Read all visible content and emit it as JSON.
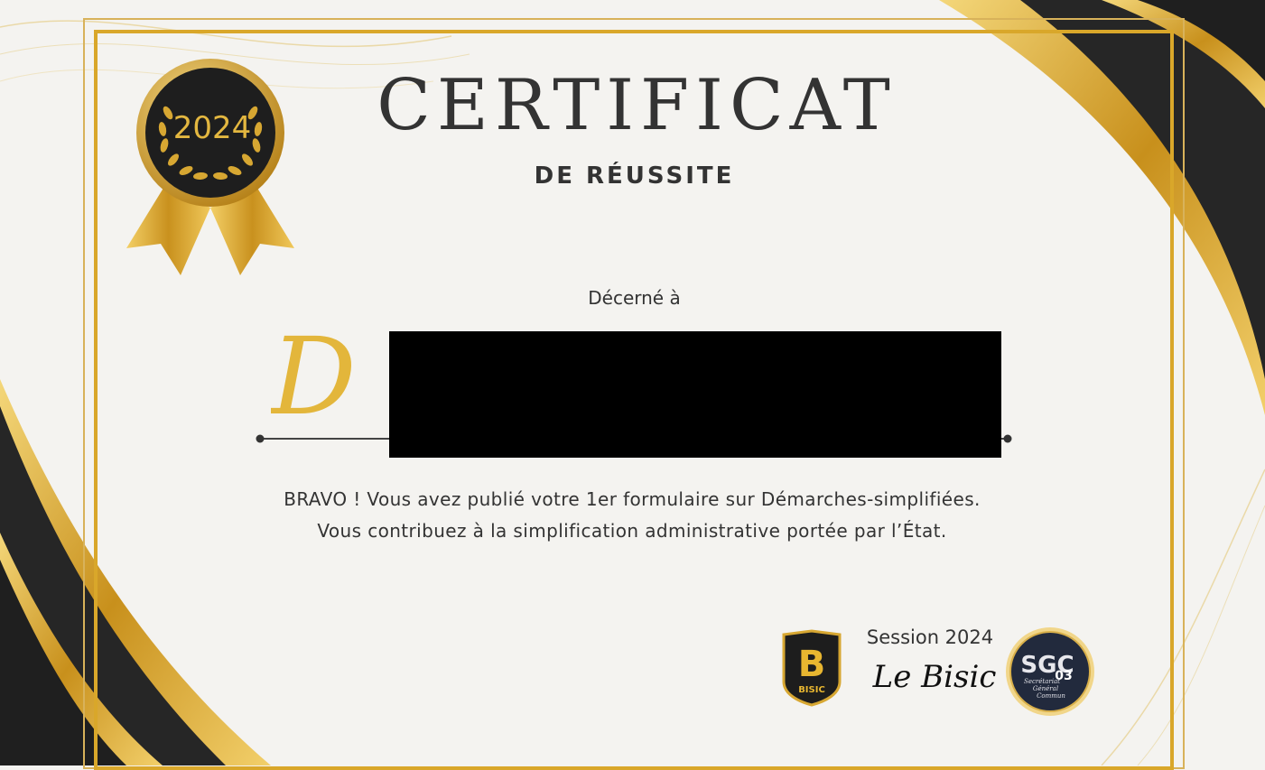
{
  "certificate": {
    "badge_year": "2024",
    "title": "CERTIFICAT",
    "subtitle": "DE RÉUSSITE",
    "awarded_to_label": "Décerné à",
    "recipient_visible_initial": "D",
    "message_line1": "BRAVO ! Vous avez publié votre 1er formulaire sur Démarches-simplifiées.",
    "message_line2": "Vous contribuez à la simplification administrative portée par l’État.",
    "session": "Session 2024",
    "signature": "Le Bisic"
  },
  "logos": {
    "bisic_text": "BISIC",
    "bisic_letter": "B",
    "sgc_text": "SGC",
    "sgc_number": "03",
    "sgc_subtext_1": "Secrétariat",
    "sgc_subtext_2": "Général",
    "sgc_subtext_3": "Commun"
  },
  "colors": {
    "gold": "#e3b63b",
    "dark": "#1f1f1f",
    "text": "#333333",
    "background": "#f4f3f0"
  }
}
